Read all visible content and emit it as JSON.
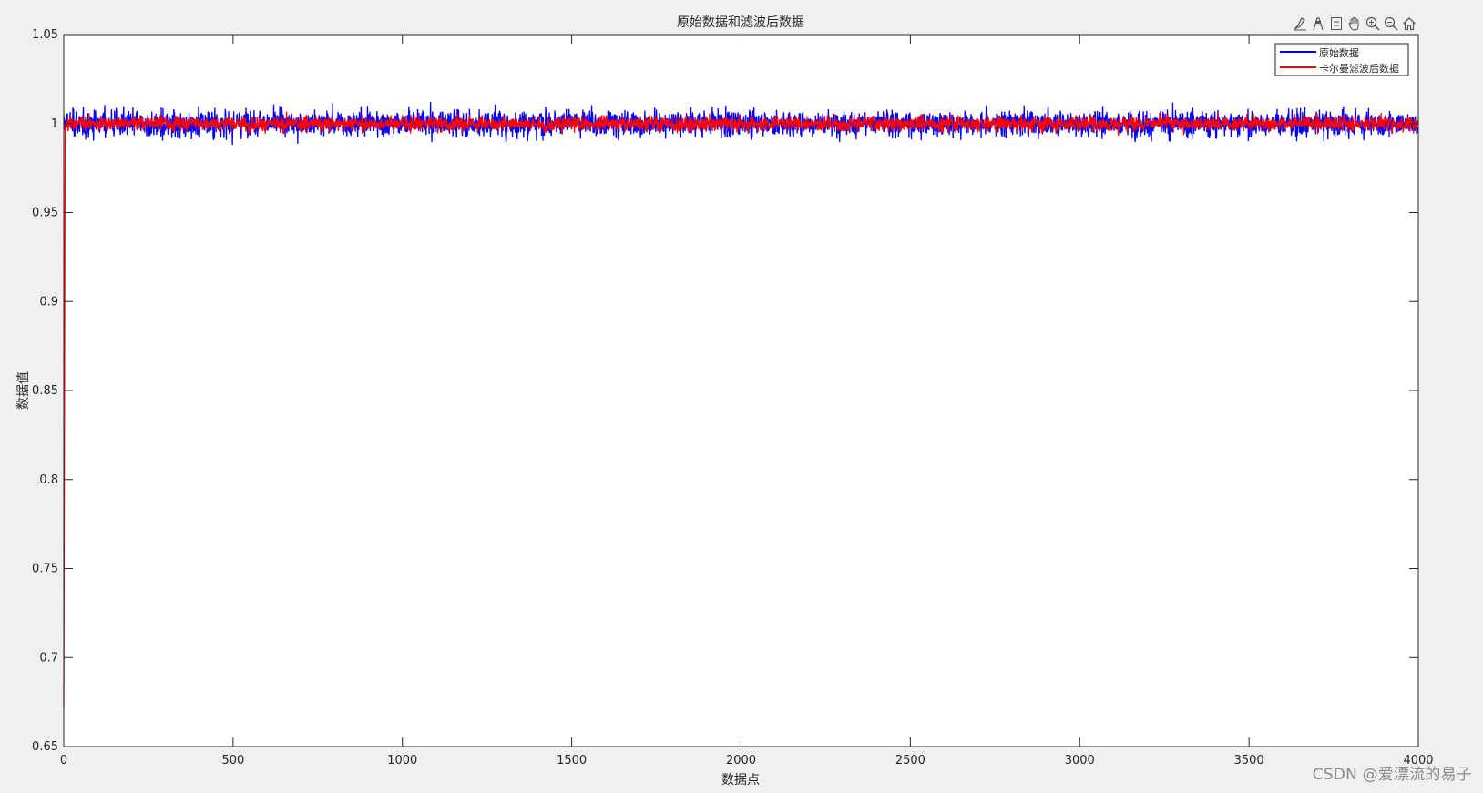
{
  "chart_data": {
    "type": "line",
    "title": "原始数据和滤波后数据",
    "xlabel": "数据点",
    "ylabel": "数据值",
    "xlim": [
      0,
      4000
    ],
    "ylim": [
      0.65,
      1.05
    ],
    "xticks": [
      0,
      500,
      1000,
      1500,
      2000,
      2500,
      3000,
      3500,
      4000
    ],
    "yticks": [
      0.65,
      0.7,
      0.75,
      0.8,
      0.85,
      0.9,
      0.95,
      1,
      1.05
    ],
    "xtick_labels": [
      "0",
      "500",
      "1000",
      "1500",
      "2000",
      "2500",
      "3000",
      "3500",
      "4000"
    ],
    "ytick_labels": [
      "0.65",
      "0.7",
      "0.75",
      "0.8",
      "0.85",
      "0.9",
      "0.95",
      "1",
      "1.05"
    ],
    "grid": false,
    "legend_position": "top-right",
    "n_points": 4000,
    "series": [
      {
        "name": "原始数据",
        "color": "#0000ff",
        "description": "noisy measurements around 1.0",
        "mean": 1.0,
        "min": 0.962,
        "max": 1.034
      },
      {
        "name": "卡尔曼滤波后数据",
        "color": "#ff0000",
        "description": "starts near 0.672 at x=0, rises to ~1.0 within first samples, then fluctuates around 1.0",
        "start_value": 0.672,
        "mean": 1.0,
        "min": 0.98,
        "max": 1.024
      }
    ]
  },
  "toolbar": {
    "icons": [
      "brush-icon",
      "data-tip-icon",
      "restore-view-icon",
      "pan-icon",
      "zoom-in-icon",
      "zoom-out-icon",
      "home-icon"
    ]
  },
  "watermark": "CSDN @爱漂流的易子"
}
